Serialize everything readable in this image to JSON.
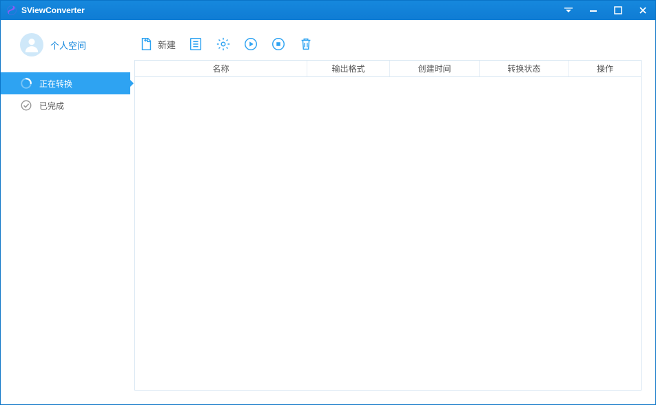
{
  "app": {
    "title": "SViewConverter"
  },
  "profile": {
    "label": "个人空间"
  },
  "sidebar": {
    "items": [
      {
        "label": "正在转换",
        "icon": "progress-circle-icon",
        "active": true
      },
      {
        "label": "已完成",
        "icon": "check-circle-icon",
        "active": false
      }
    ]
  },
  "toolbar": {
    "new_label": "新建",
    "icons": {
      "new": "new-file-icon",
      "list": "list-icon",
      "settings": "gear-icon",
      "play": "play-circle-icon",
      "stop": "stop-circle-icon",
      "delete": "trash-icon"
    }
  },
  "table": {
    "columns": [
      {
        "label": "名称"
      },
      {
        "label": "输出格式"
      },
      {
        "label": "创建时间"
      },
      {
        "label": "转换状态"
      },
      {
        "label": "操作"
      }
    ],
    "rows": []
  },
  "colors": {
    "accent": "#2ea3f2",
    "titlebar": "#1688dd"
  }
}
